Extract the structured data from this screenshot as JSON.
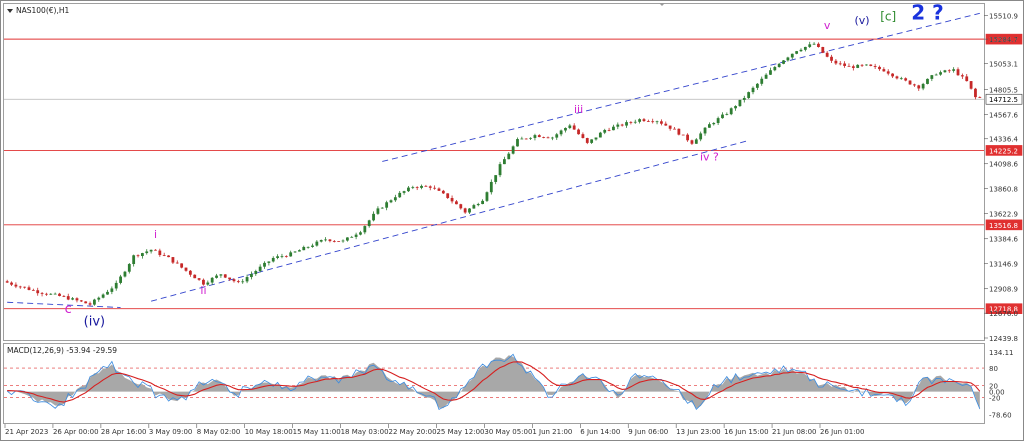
{
  "chart_title": "NAS100(€),H1",
  "indicator_title": "MACD(12,26,9) -53.94 -29.59",
  "colors": {
    "bull": "#2e7d32",
    "bear": "#c62828",
    "hline": "#e03030",
    "channel": "#3344cc",
    "macd_line": "#3a8be0",
    "signal_line": "#d62020",
    "histogram": "#a8a8a8",
    "magenta": "#d020d0",
    "navy": "#1a1a9e",
    "green": "#2e8b2e",
    "blue": "#1a33dd"
  },
  "chart_data": {
    "type": "candlestick",
    "title": "NAS100(€),H1",
    "ylim": [
      12439.8,
      15600
    ],
    "price_ticks": [
      "15510.9",
      "15284.7",
      "15053.1",
      "14805.5",
      "14567.6",
      "14336.4",
      "14098.6",
      "13860.8",
      "13622.9",
      "13384.6",
      "13146.9",
      "12908.9",
      "12676.0",
      "12439.8"
    ],
    "x_ticks": [
      "21 Apr 2023",
      "26 Apr 00:00",
      "28 Apr 16:00",
      "3 May 09:00",
      "8 May 02:00",
      "10 May 18:00",
      "15 May 11:00",
      "18 May 03:00",
      "22 May 20:00",
      "25 May 12:00",
      "30 May 05:00",
      "1 Jun 21:00",
      "6 Jun 14:00",
      "9 Jun 06:00",
      "13 Jun 23:00",
      "16 Jun 15:00",
      "21 Jun 08:00",
      "26 Jun 01:00"
    ],
    "horizontal_levels": [
      {
        "label": "15284.7",
        "value": 15284.7,
        "style": "line"
      },
      {
        "label": "14712.5",
        "value": 14712.5,
        "style": "current"
      },
      {
        "label": "14225.2",
        "value": 14225.2,
        "style": "line"
      },
      {
        "label": "13516.8",
        "value": 13516.8,
        "style": "line"
      },
      {
        "label": "12718.8",
        "value": 12718.8,
        "style": "line"
      }
    ],
    "price_path": [
      [
        0,
        12980
      ],
      [
        8,
        12880
      ],
      [
        14,
        12830
      ],
      [
        20,
        12760
      ],
      [
        26,
        12950
      ],
      [
        30,
        13220
      ],
      [
        34,
        13280
      ],
      [
        38,
        13200
      ],
      [
        42,
        13080
      ],
      [
        46,
        12960
      ],
      [
        50,
        13050
      ],
      [
        54,
        12960
      ],
      [
        58,
        13080
      ],
      [
        62,
        13200
      ],
      [
        66,
        13240
      ],
      [
        70,
        13310
      ],
      [
        74,
        13380
      ],
      [
        78,
        13360
      ],
      [
        82,
        13460
      ],
      [
        86,
        13660
      ],
      [
        90,
        13790
      ],
      [
        94,
        13880
      ],
      [
        98,
        13880
      ],
      [
        102,
        13780
      ],
      [
        106,
        13640
      ],
      [
        110,
        13760
      ],
      [
        114,
        14080
      ],
      [
        118,
        14320
      ],
      [
        122,
        14370
      ],
      [
        126,
        14350
      ],
      [
        130,
        14470
      ],
      [
        134,
        14290
      ],
      [
        138,
        14420
      ],
      [
        142,
        14470
      ],
      [
        146,
        14520
      ],
      [
        150,
        14510
      ],
      [
        154,
        14420
      ],
      [
        158,
        14300
      ],
      [
        162,
        14470
      ],
      [
        166,
        14580
      ],
      [
        170,
        14730
      ],
      [
        174,
        14900
      ],
      [
        178,
        15060
      ],
      [
        182,
        15180
      ],
      [
        186,
        15240
      ],
      [
        190,
        15070
      ],
      [
        194,
        15020
      ],
      [
        198,
        15030
      ],
      [
        202,
        14990
      ],
      [
        206,
        14900
      ],
      [
        210,
        14830
      ],
      [
        214,
        14960
      ],
      [
        218,
        14990
      ],
      [
        221,
        14880
      ],
      [
        223,
        14730
      ]
    ],
    "macd": {
      "levels": [
        "134.11",
        "80",
        "20",
        "0.00",
        "-20",
        "-78.60"
      ],
      "ylim": [
        -100,
        155
      ],
      "points": [
        [
          0,
          10
        ],
        [
          6,
          -25
        ],
        [
          12,
          -50
        ],
        [
          16,
          5
        ],
        [
          20,
          55
        ],
        [
          24,
          90
        ],
        [
          28,
          40
        ],
        [
          32,
          10
        ],
        [
          36,
          -20
        ],
        [
          40,
          -25
        ],
        [
          44,
          20
        ],
        [
          48,
          45
        ],
        [
          52,
          -10
        ],
        [
          56,
          15
        ],
        [
          60,
          35
        ],
        [
          64,
          15
        ],
        [
          68,
          35
        ],
        [
          72,
          55
        ],
        [
          76,
          40
        ],
        [
          80,
          60
        ],
        [
          84,
          95
        ],
        [
          88,
          40
        ],
        [
          92,
          20
        ],
        [
          96,
          -20
        ],
        [
          100,
          -55
        ],
        [
          104,
          0
        ],
        [
          108,
          70
        ],
        [
          112,
          110
        ],
        [
          116,
          125
        ],
        [
          120,
          60
        ],
        [
          124,
          -10
        ],
        [
          128,
          15
        ],
        [
          132,
          60
        ],
        [
          136,
          35
        ],
        [
          140,
          -20
        ],
        [
          144,
          55
        ],
        [
          148,
          40
        ],
        [
          152,
          15
        ],
        [
          156,
          -30
        ],
        [
          158,
          -60
        ],
        [
          162,
          15
        ],
        [
          166,
          45
        ],
        [
          170,
          65
        ],
        [
          174,
          60
        ],
        [
          178,
          75
        ],
        [
          182,
          60
        ],
        [
          186,
          25
        ],
        [
          190,
          15
        ],
        [
          194,
          5
        ],
        [
          198,
          -5
        ],
        [
          202,
          -10
        ],
        [
          206,
          -45
        ],
        [
          210,
          40
        ],
        [
          214,
          50
        ],
        [
          218,
          30
        ],
        [
          221,
          20
        ],
        [
          223,
          -54
        ]
      ]
    },
    "wave_labels": [
      {
        "text": "c",
        "x": 14,
        "price": 12680,
        "color": "magenta",
        "size": 13
      },
      {
        "text": "(iv)",
        "x": 20,
        "price": 12560,
        "color": "navy",
        "size": 13
      },
      {
        "text": "i",
        "x": 34,
        "price": 13390,
        "color": "magenta",
        "size": 11
      },
      {
        "text": "ii",
        "x": 45,
        "price": 12860,
        "color": "magenta",
        "size": 11
      },
      {
        "text": "iii",
        "x": 131,
        "price": 14580,
        "color": "magenta",
        "size": 11
      },
      {
        "text": "iv ?",
        "x": 161,
        "price": 14130,
        "color": "magenta",
        "size": 11
      },
      {
        "text": "v",
        "x": 188,
        "price": 15380,
        "color": "magenta",
        "size": 11
      },
      {
        "text": "(v)",
        "x": 196,
        "price": 15430,
        "color": "navy",
        "size": 11
      },
      {
        "text": "[c]",
        "x": 202,
        "price": 15460,
        "color": "green",
        "size": 12
      },
      {
        "text": "2 ?",
        "x": 211,
        "price": 15470,
        "color": "blue",
        "size": 20
      }
    ],
    "channel_lines": [
      {
        "from": [
          86,
          14120
        ],
        "to": [
          223,
          15530
        ]
      },
      {
        "from": [
          33,
          12790
        ],
        "to": [
          170,
          14320
        ]
      },
      {
        "from": [
          0,
          12780
        ],
        "to": [
          26,
          12730
        ]
      }
    ]
  }
}
